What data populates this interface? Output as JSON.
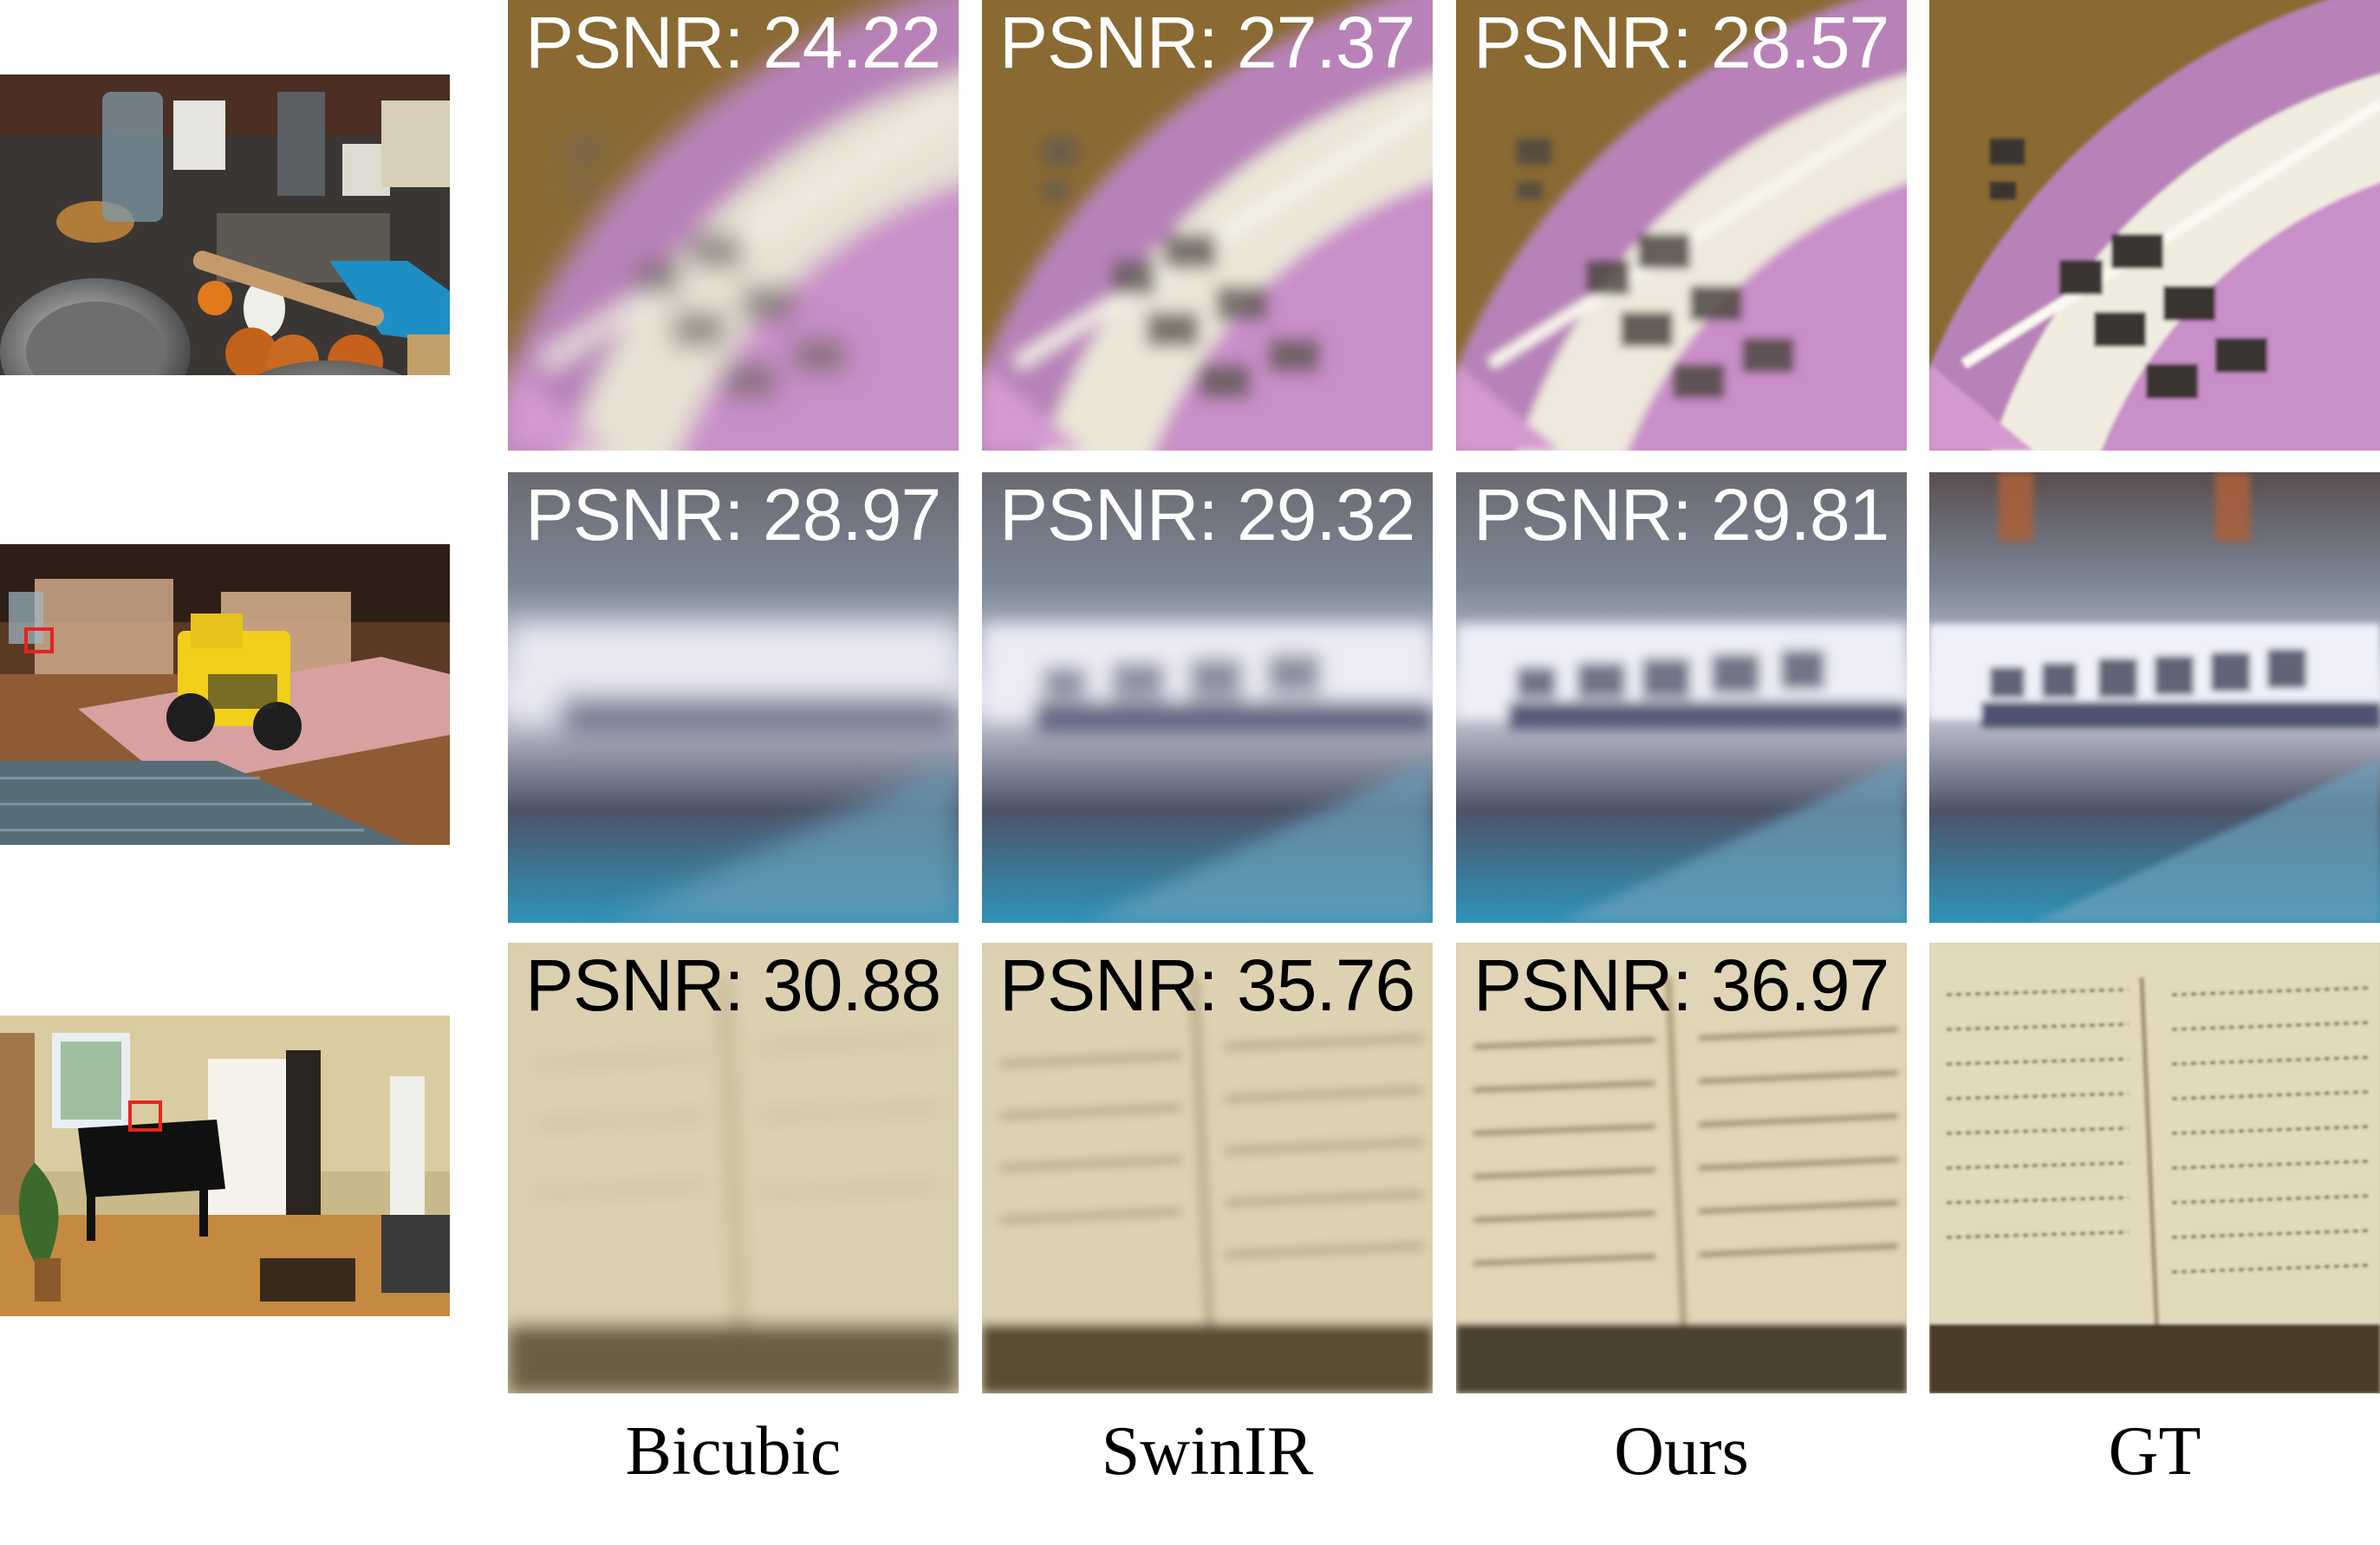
{
  "figure": {
    "column_labels": [
      "Bicubic",
      "SwinIR",
      "Ours",
      "GT"
    ],
    "rows": [
      {
        "scene": "kitchen",
        "psnr": [
          "PSNR: 24.22",
          "PSNR: 27.37",
          "PSNR: 28.57"
        ],
        "psnr_text_color": "#ffffff"
      },
      {
        "scene": "lego",
        "psnr": [
          "PSNR: 28.97",
          "PSNR: 29.32",
          "PSNR: 29.81"
        ],
        "psnr_text_color": "#ffffff"
      },
      {
        "scene": "room",
        "psnr": [
          "PSNR: 30.88",
          "PSNR: 35.76",
          "PSNR: 36.97"
        ],
        "psnr_text_color": "#000000"
      }
    ],
    "highlight_box_color": "#e5241f"
  }
}
